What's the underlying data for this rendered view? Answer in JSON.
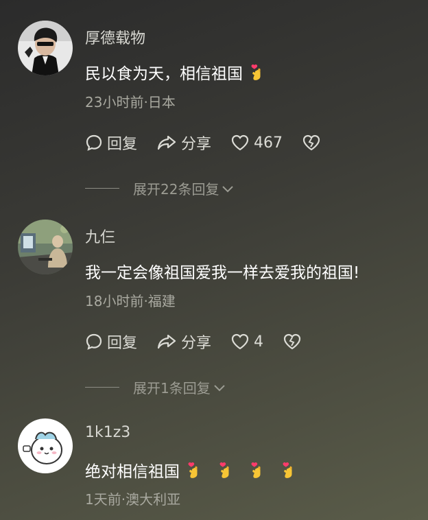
{
  "comments": [
    {
      "username": "厚德载物",
      "text": "民以食为天，相信祖国",
      "emoji_count": 1,
      "meta": "23小时前·日本",
      "reply_label": "回复",
      "share_label": "分享",
      "likes": "467",
      "expand_label": "展开22条回复"
    },
    {
      "username": "九仨",
      "text": "我一定会像祖国爱我一样去爱我的祖国!",
      "emoji_count": 0,
      "meta": "18小时前·福建",
      "reply_label": "回复",
      "share_label": "分享",
      "likes": "4",
      "expand_label": "展开1条回复"
    },
    {
      "username": "1k1z3",
      "text": "绝对相信祖国",
      "emoji_count": 4,
      "meta": "1天前·澳大利亚"
    }
  ],
  "icons": {
    "reply": "comment-bubble-icon",
    "share": "share-arrow-icon",
    "like": "heart-icon",
    "dislike": "broken-heart-icon",
    "expand": "chevron-down-icon",
    "emoji": "finger-heart-emoji"
  },
  "colors": {
    "text_primary": "#ffffff",
    "text_secondary": "#a9a9a0",
    "username": "#d8d8d2"
  }
}
